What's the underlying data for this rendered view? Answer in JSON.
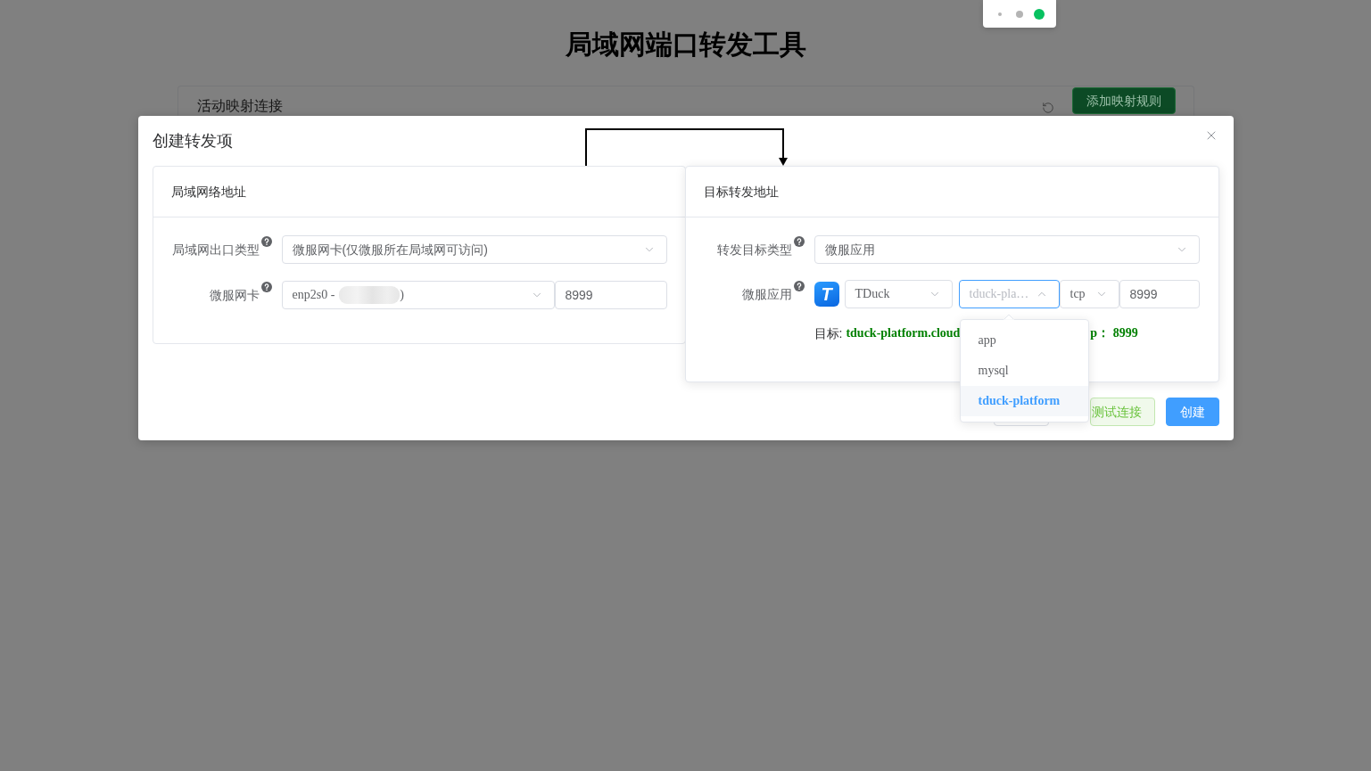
{
  "page": {
    "title": "局域网端口转发工具",
    "card_title": "活动映射连接",
    "add_button": "添加映射规则"
  },
  "dialog": {
    "title": "创建转发项",
    "source": {
      "title": "局域网络地址",
      "fields": [
        {
          "kind": "select",
          "label": "局域网出口类型",
          "value": "微服网卡(仅微服所在局域网可访问)"
        },
        {
          "kind": "interface",
          "label": "微服网卡",
          "value": "enp2s0 -",
          "value_tail": ")",
          "port": "8999"
        }
      ]
    },
    "target": {
      "title": "目标转发地址",
      "fields": [
        {
          "kind": "select",
          "label": "转发目标类型",
          "value": "微服应用"
        },
        {
          "kind": "app",
          "label": "微服应用",
          "logo_letter": "T",
          "app": "TDuck",
          "service": "tduck-pla…",
          "open": true,
          "service_options": [
            {
              "label": "app",
              "selected": false
            },
            {
              "label": "mysql",
              "selected": false
            },
            {
              "label": "tduck-platform",
              "selected": true
            }
          ],
          "protocol": "tcp",
          "port": "8999"
        }
      ],
      "result_label": "目标:",
      "result_host": "tduck-platform.cloud",
      "result_port": "p： 8999"
    },
    "buttons": [
      {
        "kind": "plain"
      },
      {
        "kind": "success",
        "label": "测试连接"
      },
      {
        "kind": "primary",
        "label": "创建"
      }
    ]
  }
}
